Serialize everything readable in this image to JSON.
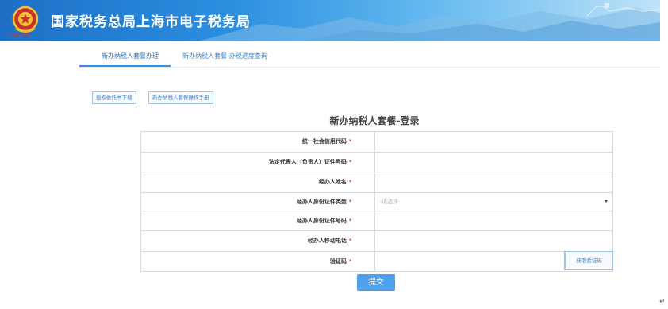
{
  "header": {
    "title": "国家税务总局上海市电子税务局",
    "emblem_caption": "中国税务"
  },
  "tabs": [
    {
      "label": "新办纳税人套餐办理",
      "active": true
    },
    {
      "label": "新办纳税人套餐-办税进度查询",
      "active": false
    }
  ],
  "downloads": {
    "authorization_form": "授权委托书下载",
    "manual": "新办纳税人套餐操作手册"
  },
  "form": {
    "title": "新办纳税人套餐-登录",
    "fields": [
      {
        "label": "统一社会信用代码",
        "required": "*",
        "value": ""
      },
      {
        "label": "法定代表人（负责人）证件号码",
        "required": "*",
        "value": ""
      },
      {
        "label": "经办人姓名",
        "required": "*",
        "value": ""
      },
      {
        "label": "经办人身份证件类型",
        "required": "*",
        "placeholder": "-请选择-"
      },
      {
        "label": "经办人身份证件号码",
        "required": "*",
        "value": ""
      },
      {
        "label": "经办人移动电话",
        "required": "*",
        "value": ""
      },
      {
        "label": "验证码",
        "required": "*",
        "value": ""
      }
    ],
    "get_code_label": "获取验证码",
    "submit_label": "提交"
  },
  "colors": {
    "accent": "#3a8ee6",
    "submit": "#4ea1ee",
    "required": "#e03a3a"
  },
  "misc": {
    "return_mark": "↵"
  }
}
